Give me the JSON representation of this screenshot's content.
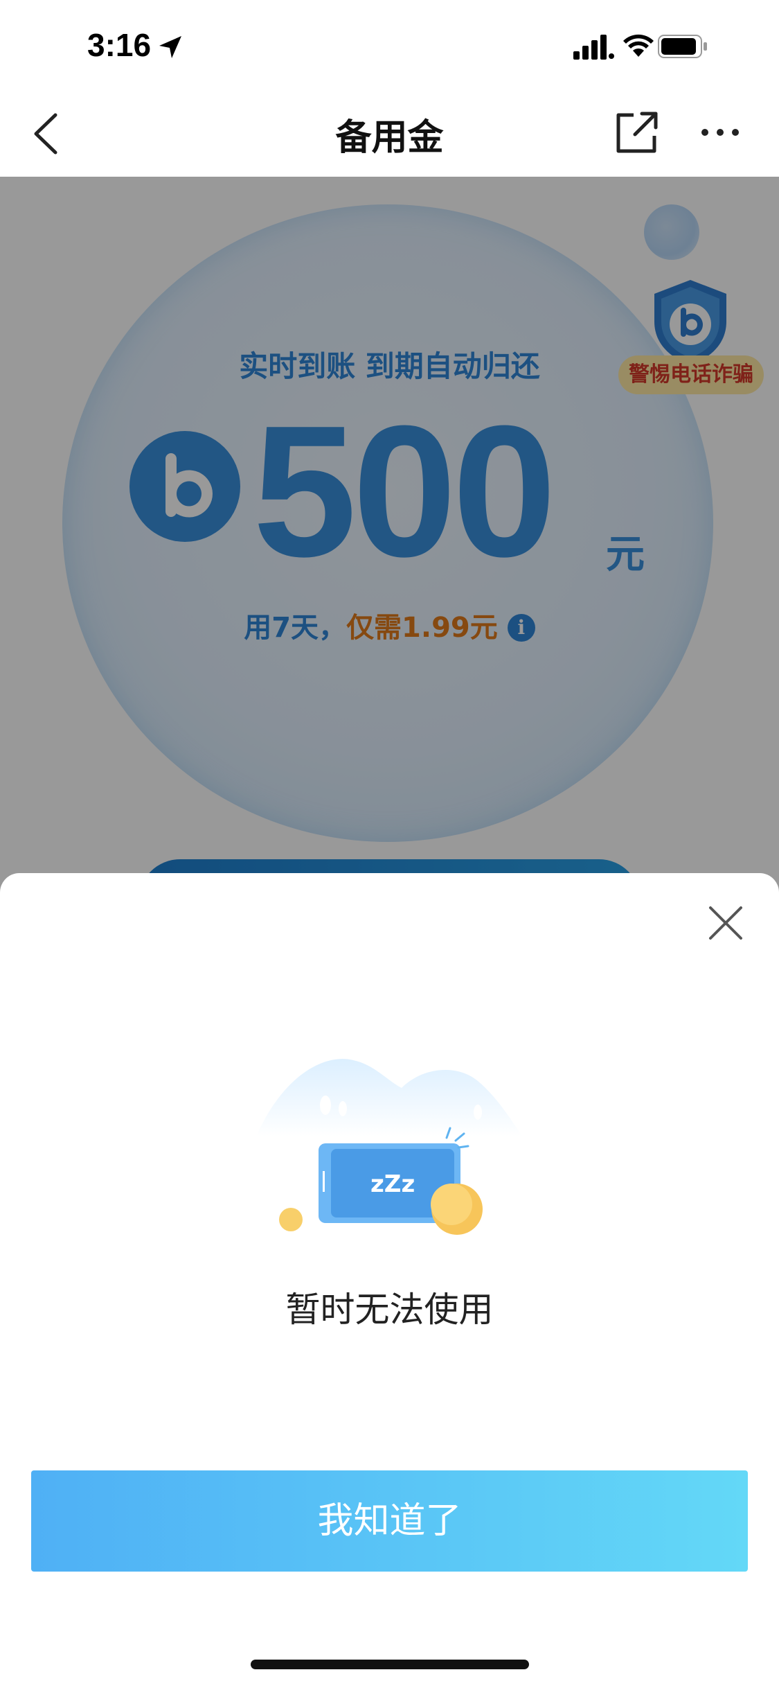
{
  "status_bar": {
    "time": "3:16"
  },
  "nav": {
    "title": "备用金"
  },
  "loan_card": {
    "tagline": "实时到账 到期自动归还",
    "amount": "500",
    "unit": "元",
    "price_prefix": "用7天，",
    "price_highlight": "仅需1.99元",
    "warning_badge": "警惕电话诈骗"
  },
  "dialog": {
    "message": "暂时无法使用",
    "confirm_label": "我知道了",
    "illustration_text": "zZz"
  },
  "colors": {
    "accent_blue": "#2f86d8",
    "accent_orange": "#e07a1b",
    "button_gradient_start": "#4fb0f5",
    "button_gradient_end": "#63d8f7",
    "warning_red": "#d43a2a"
  }
}
